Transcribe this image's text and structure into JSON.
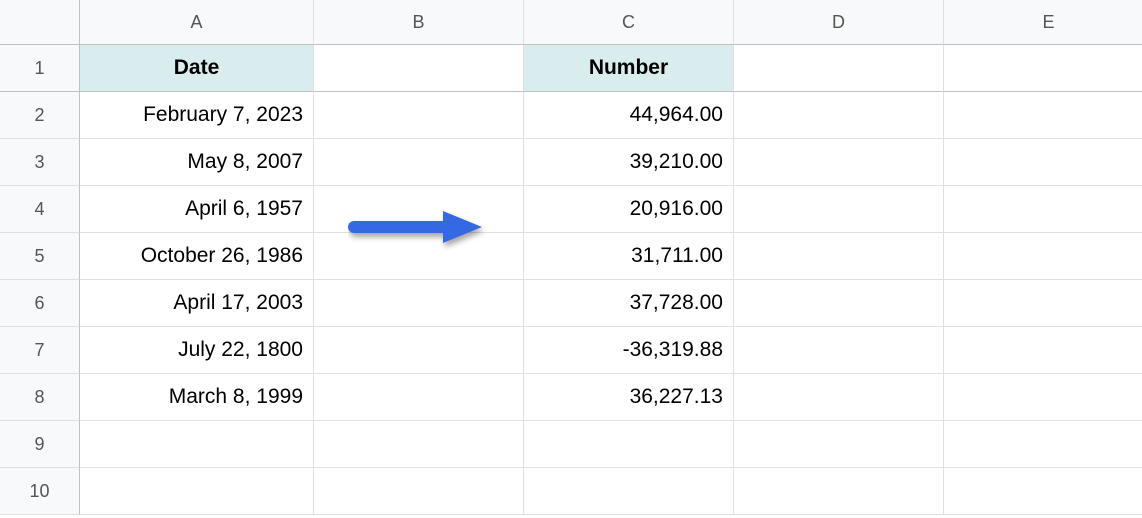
{
  "columns": [
    "A",
    "B",
    "C",
    "D",
    "E"
  ],
  "rows": [
    "1",
    "2",
    "3",
    "4",
    "5",
    "6",
    "7",
    "8",
    "9",
    "10"
  ],
  "headers": {
    "A": "Date",
    "C": "Number"
  },
  "data": [
    {
      "A": "February 7, 2023",
      "B": "",
      "C": "44,964.00",
      "D": "",
      "E": ""
    },
    {
      "A": "May 8, 2007",
      "B": "",
      "C": "39,210.00",
      "D": "",
      "E": ""
    },
    {
      "A": "April 6, 1957",
      "B": "",
      "C": "20,916.00",
      "D": "",
      "E": ""
    },
    {
      "A": "October 26, 1986",
      "B": "",
      "C": "31,711.00",
      "D": "",
      "E": ""
    },
    {
      "A": "April 17, 2003",
      "B": "",
      "C": "37,728.00",
      "D": "",
      "E": ""
    },
    {
      "A": "July 22, 1800",
      "B": "",
      "C": "-36,319.88",
      "D": "",
      "E": ""
    },
    {
      "A": "March 8, 1999",
      "B": "",
      "C": "36,227.13",
      "D": "",
      "E": ""
    },
    {
      "A": "",
      "B": "",
      "C": "",
      "D": "",
      "E": ""
    },
    {
      "A": "",
      "B": "",
      "C": "",
      "D": "",
      "E": ""
    }
  ],
  "arrow_color": "#3569e3"
}
